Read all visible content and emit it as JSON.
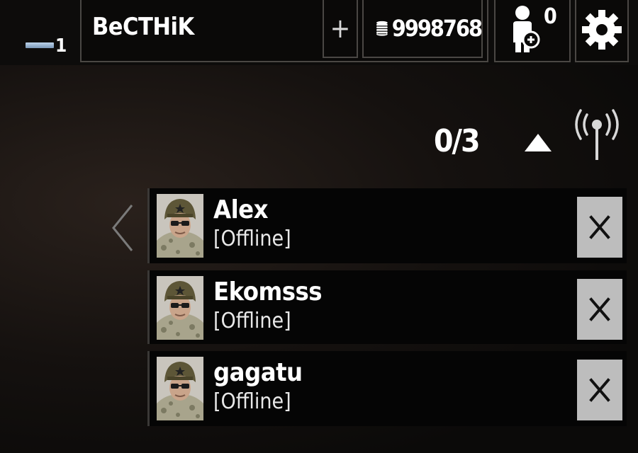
{
  "header": {
    "level": "1",
    "player_name": "BeCTHiK",
    "add_label": "+",
    "coins": "9998768",
    "invites": "0"
  },
  "friends_panel": {
    "counter": "0/3",
    "friends": [
      {
        "name": "Alex",
        "status": "[Offline]"
      },
      {
        "name": "Ekomsss",
        "status": "[Offline]"
      },
      {
        "name": "gagatu",
        "status": "[Offline]"
      }
    ]
  },
  "icons": [
    "level-bar-icon",
    "coins-icon",
    "invite-friend-icon",
    "gear-icon",
    "collapse-arrow-icon",
    "antenna-icon",
    "back-arrow-icon",
    "soldier-avatar",
    "close-icon"
  ],
  "colors": {
    "remove_button": "#bdbdbd",
    "panel_border": "#4a4744",
    "level_bar": "#9fb7d1"
  }
}
